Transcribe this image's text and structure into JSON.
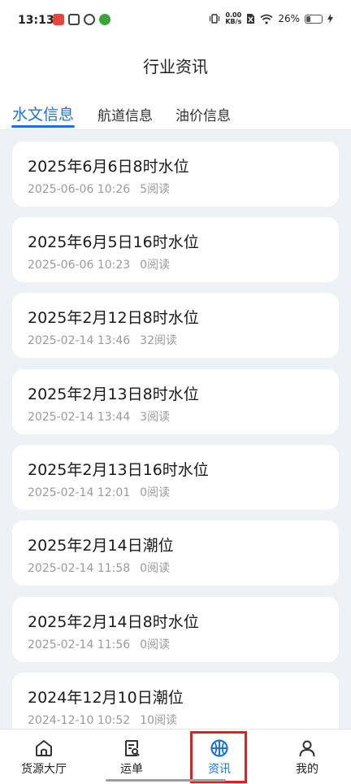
{
  "status_bar": {
    "time": "13:13",
    "net_speed_value": "0.00",
    "net_speed_unit": "KB/s",
    "battery": "26%",
    "battery_level": 0.26
  },
  "header": {
    "title": "行业资讯"
  },
  "tabs": [
    {
      "label": "水文信息",
      "active": true
    },
    {
      "label": "航道信息",
      "active": false
    },
    {
      "label": "油价信息",
      "active": false
    }
  ],
  "articles": [
    {
      "title": "2025年6月6日8时水位",
      "date": "2025-06-06 10:26",
      "reads": "5阅读"
    },
    {
      "title": "2025年6月5日16时水位",
      "date": "2025-06-06 10:23",
      "reads": "0阅读"
    },
    {
      "title": "2025年2月12日8时水位",
      "date": "2025-02-14 13:46",
      "reads": "32阅读"
    },
    {
      "title": "2025年2月13日8时水位",
      "date": "2025-02-14 13:44",
      "reads": "3阅读"
    },
    {
      "title": "2025年2月13日16时水位",
      "date": "2025-02-14 12:01",
      "reads": "0阅读"
    },
    {
      "title": "2025年2月14日潮位",
      "date": "2025-02-14 11:58",
      "reads": "0阅读"
    },
    {
      "title": "2025年2月14日8时水位",
      "date": "2025-02-14 11:56",
      "reads": "0阅读"
    },
    {
      "title": "2024年12月10日潮位",
      "date": "2024-12-10 10:52",
      "reads": "10阅读"
    }
  ],
  "bottom_nav": [
    {
      "label": "货源大厅",
      "icon": "home-icon",
      "active": false
    },
    {
      "label": "运单",
      "icon": "waybill-icon",
      "active": false
    },
    {
      "label": "资讯",
      "icon": "news-icon",
      "active": true
    },
    {
      "label": "我的",
      "icon": "profile-icon",
      "active": false
    }
  ],
  "colors": {
    "accent": "#1a73d9",
    "highlight": "#e02020",
    "background": "#eef2f6"
  }
}
